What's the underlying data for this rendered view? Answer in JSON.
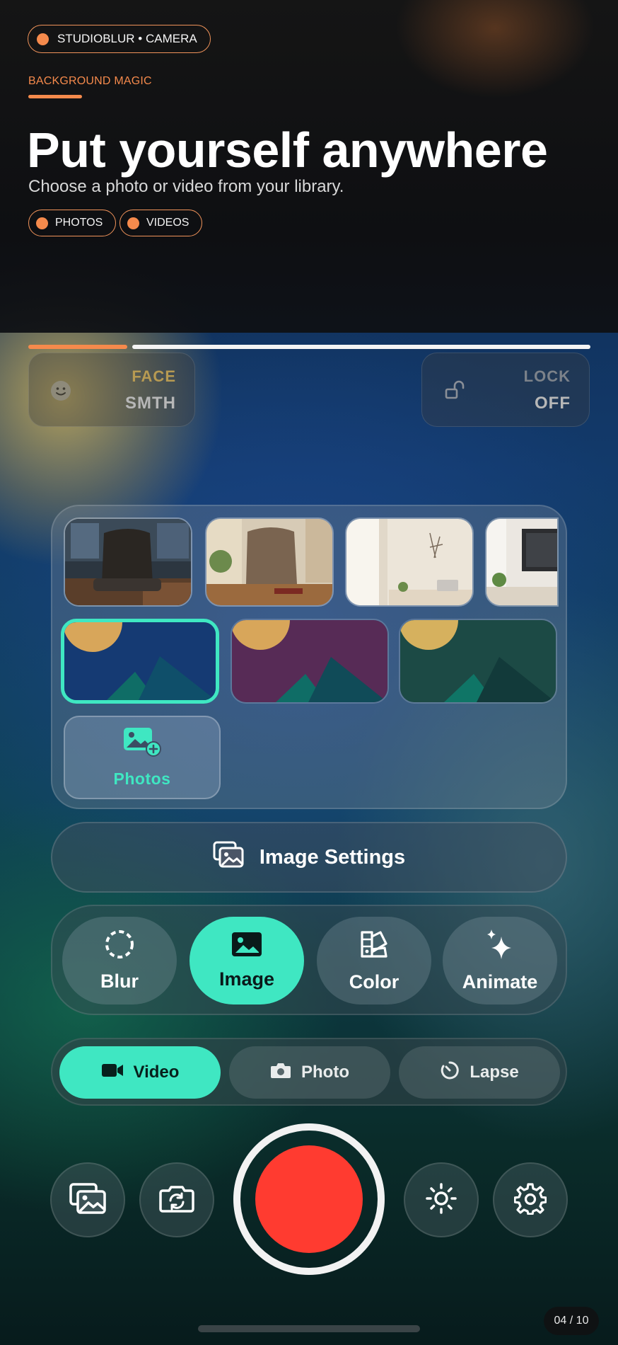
{
  "header": {
    "brand_chip": "STUDIOBLUR • CAMERA",
    "eyebrow": "BACKGROUND MAGIC",
    "title": "Put yourself anywhere",
    "subtitle": "Choose a photo or video from your library.",
    "pills": [
      "PHOTOS",
      "VIDEOS"
    ]
  },
  "status_cards": {
    "face": {
      "key": "FACE",
      "value": "SMTH",
      "icon": "smiley-face-icon"
    },
    "lock": {
      "key": "LOCK",
      "value": "OFF",
      "icon": "unlock-icon"
    }
  },
  "gallery": {
    "photos_label": "Photos",
    "photo_thumbnails": [
      "office-chair-photo",
      "desk-chair-photo",
      "bright-room-photo",
      "monitor-desk-photo"
    ],
    "background_presets": [
      "blue-landscape",
      "purple-landscape",
      "green-landscape"
    ],
    "selected_preset": "blue-landscape"
  },
  "image_settings_label": "Image Settings",
  "effects": {
    "items": [
      {
        "label": "Blur",
        "icon": "dashed-circle-icon"
      },
      {
        "label": "Image",
        "icon": "image-icon"
      },
      {
        "label": "Color",
        "icon": "palette-icon"
      },
      {
        "label": "Animate",
        "icon": "sparkles-icon"
      }
    ],
    "active": "Image"
  },
  "modes": {
    "items": [
      {
        "label": "Video",
        "icon": "video-camera-icon"
      },
      {
        "label": "Photo",
        "icon": "camera-icon"
      },
      {
        "label": "Lapse",
        "icon": "timer-icon"
      }
    ],
    "active": "Video"
  },
  "bottom_bar": {
    "buttons": [
      "gallery-icon",
      "flip-camera-icon",
      "shutter",
      "brightness-icon",
      "settings-gear-icon"
    ]
  },
  "page_counter": "04 / 10",
  "colors": {
    "accent_orange": "#f58a4c",
    "accent_mint": "#3fe7c2",
    "record_red": "#ff3b30"
  }
}
